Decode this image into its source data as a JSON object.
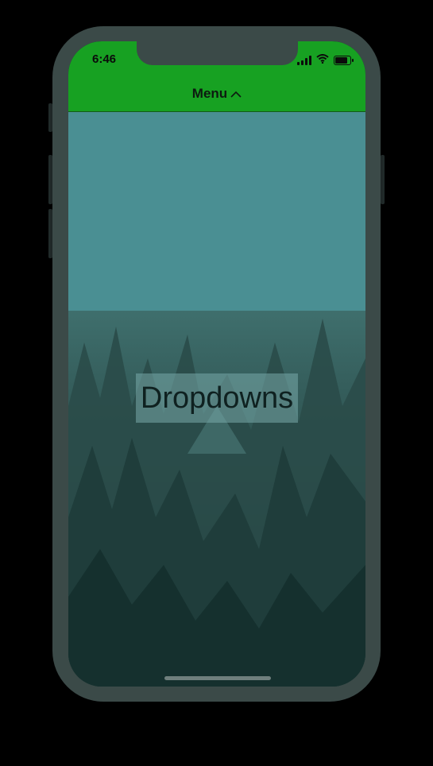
{
  "status_bar": {
    "time": "6:46"
  },
  "nav": {
    "menu_label": "Menu"
  },
  "content": {
    "title": "Dropdowns"
  },
  "icons": {
    "menu_chevron": "chevron-up-icon",
    "signal": "cellular-signal-icon",
    "wifi": "wifi-icon",
    "battery": "battery-icon"
  },
  "colors": {
    "nav_bar": "#17a122",
    "dropdown_panel": "#4a8f93",
    "device_frame": "#3b4a48",
    "title_text": "#0f2120"
  }
}
